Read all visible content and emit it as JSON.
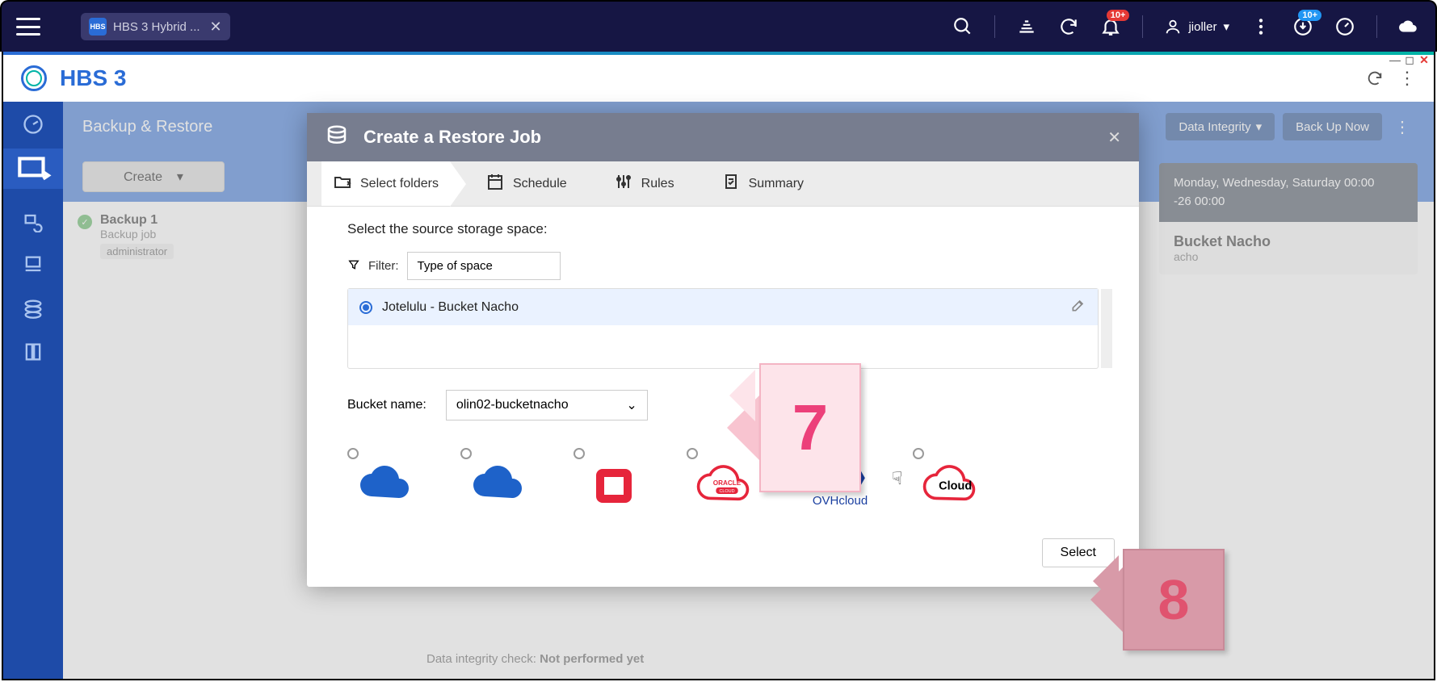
{
  "os": {
    "tab_title": "HBS 3 Hybrid ...",
    "tab_icon": "HBS",
    "username": "jioller",
    "badge1": "10+",
    "badge2": "10+"
  },
  "app": {
    "title": "HBS 3",
    "section": "Backup & Restore",
    "create_label": "Create",
    "btn_integrity": "Data Integrity",
    "btn_backup": "Back Up Now"
  },
  "job": {
    "name": "Backup 1",
    "type": "Backup job",
    "owner": "administrator"
  },
  "info": {
    "schedule1": "Monday, Wednesday, Saturday 00:00",
    "schedule2": "-26 00:00",
    "dest_title": "Bucket Nacho",
    "dest_sub": "acho"
  },
  "modal": {
    "title": "Create a Restore Job",
    "steps": {
      "select_folders": "Select folders",
      "schedule": "Schedule",
      "rules": "Rules",
      "summary": "Summary"
    },
    "prompt": "Select the source storage space:",
    "filter_label": "Filter:",
    "filter_value": "Type of space",
    "source_name": "Jotelulu - Bucket Nacho",
    "bucket_label": "Bucket name:",
    "bucket_value": "olin02-bucketnacho",
    "select_btn": "Select",
    "cloud5": "OVHcloud",
    "cloud6": "Cloud"
  },
  "bottom": {
    "integrity_label": "Data integrity check:",
    "integrity_value": "Not performed yet"
  },
  "callouts": {
    "c7": "7",
    "c8": "8"
  }
}
